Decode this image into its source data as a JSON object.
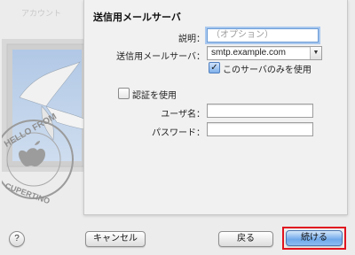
{
  "window": {
    "faded_title": "アカウント"
  },
  "sheet": {
    "section_title": "送信用メールサーバ",
    "description_label": "説明：",
    "description_placeholder": "（オプション）",
    "server_label": "送信用メールサーバ：",
    "server_value": "smtp.example.com",
    "only_this_server_label": "このサーバのみを使用",
    "only_this_server_checked": true,
    "use_auth_label": "認証を使用",
    "use_auth_checked": false,
    "username_label": "ユーザ名：",
    "username_value": "",
    "password_label": "パスワード：",
    "password_value": ""
  },
  "buttons": {
    "help": "?",
    "cancel": "キャンセル",
    "back": "戻る",
    "continue": "続ける"
  },
  "stamp": {
    "text_top": "HELLO FROM",
    "text_bottom": "CUPERTINO"
  },
  "colors": {
    "highlight": "#e0141f",
    "default_button": "#6ea8ea",
    "focus_ring": "#a9c8ef"
  }
}
